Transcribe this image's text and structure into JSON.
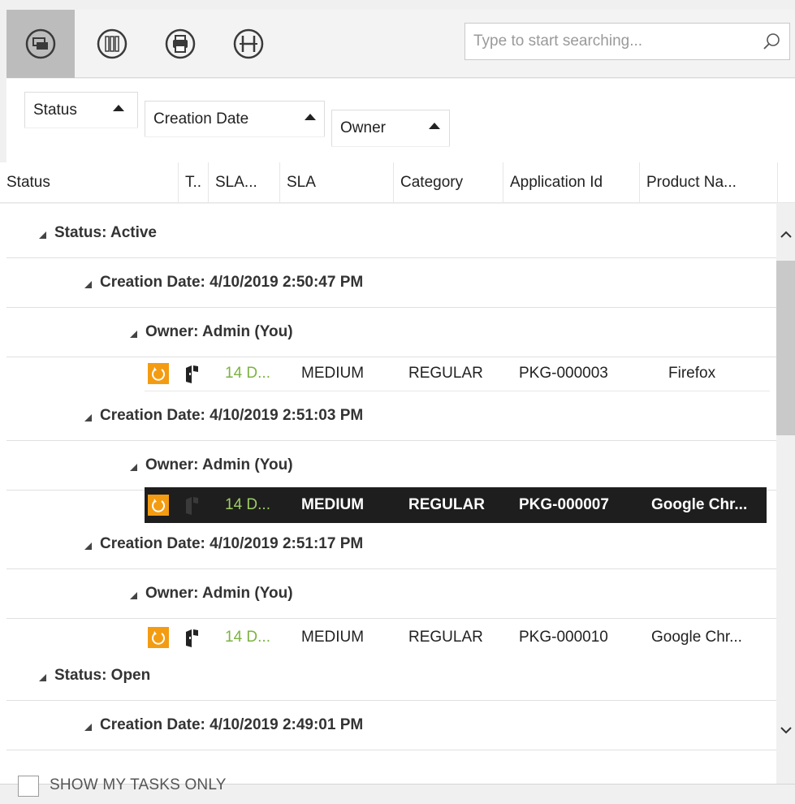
{
  "toolbar": {
    "buttons": [
      {
        "name": "switch-view-icon",
        "active": true
      },
      {
        "name": "columns-icon",
        "active": false
      },
      {
        "name": "print-icon",
        "active": false
      },
      {
        "name": "history-icon",
        "active": false
      }
    ],
    "search_placeholder": "Type to start searching...",
    "search_value": ""
  },
  "grouping": {
    "chips": [
      "Status",
      "Creation Date",
      "Owner"
    ]
  },
  "columns": [
    "Status",
    "T..",
    "SLA...",
    "SLA",
    "Category",
    "Application Id",
    "Product Na..."
  ],
  "groups": [
    {
      "label": "Status: Active"
    },
    {
      "label": "Creation Date: 4/10/2019 2:50:47 PM"
    },
    {
      "label": "Owner: Admin (You)"
    },
    {
      "label": "Creation Date: 4/10/2019 2:51:03 PM"
    },
    {
      "label": "Owner: Admin (You)"
    },
    {
      "label": "Creation Date: 4/10/2019 2:51:17 PM"
    },
    {
      "label": "Owner: Admin (You)"
    },
    {
      "label": "Status: Open"
    },
    {
      "label": "Creation Date: 4/10/2019 2:49:01 PM"
    }
  ],
  "rows": [
    {
      "sla_time": "14 D...",
      "sla": "MEDIUM",
      "category": "REGULAR",
      "application_id": "PKG-000003",
      "product": "Firefox",
      "selected": false
    },
    {
      "sla_time": "14 D...",
      "sla": "MEDIUM",
      "category": "REGULAR",
      "application_id": "PKG-000007",
      "product": "Google Chr...",
      "selected": true
    },
    {
      "sla_time": "14 D...",
      "sla": "MEDIUM",
      "category": "REGULAR",
      "application_id": "PKG-000010",
      "product": "Google Chr...",
      "selected": false
    }
  ],
  "footer": {
    "show_my_tasks_label": "SHOW MY TASKS ONLY",
    "show_my_tasks_checked": false
  },
  "colors": {
    "status_active": "#f39c12",
    "sla_time": "#7cb342",
    "selected_row": "#1e1e1e",
    "toolbar_active": "#bcbcbc"
  }
}
